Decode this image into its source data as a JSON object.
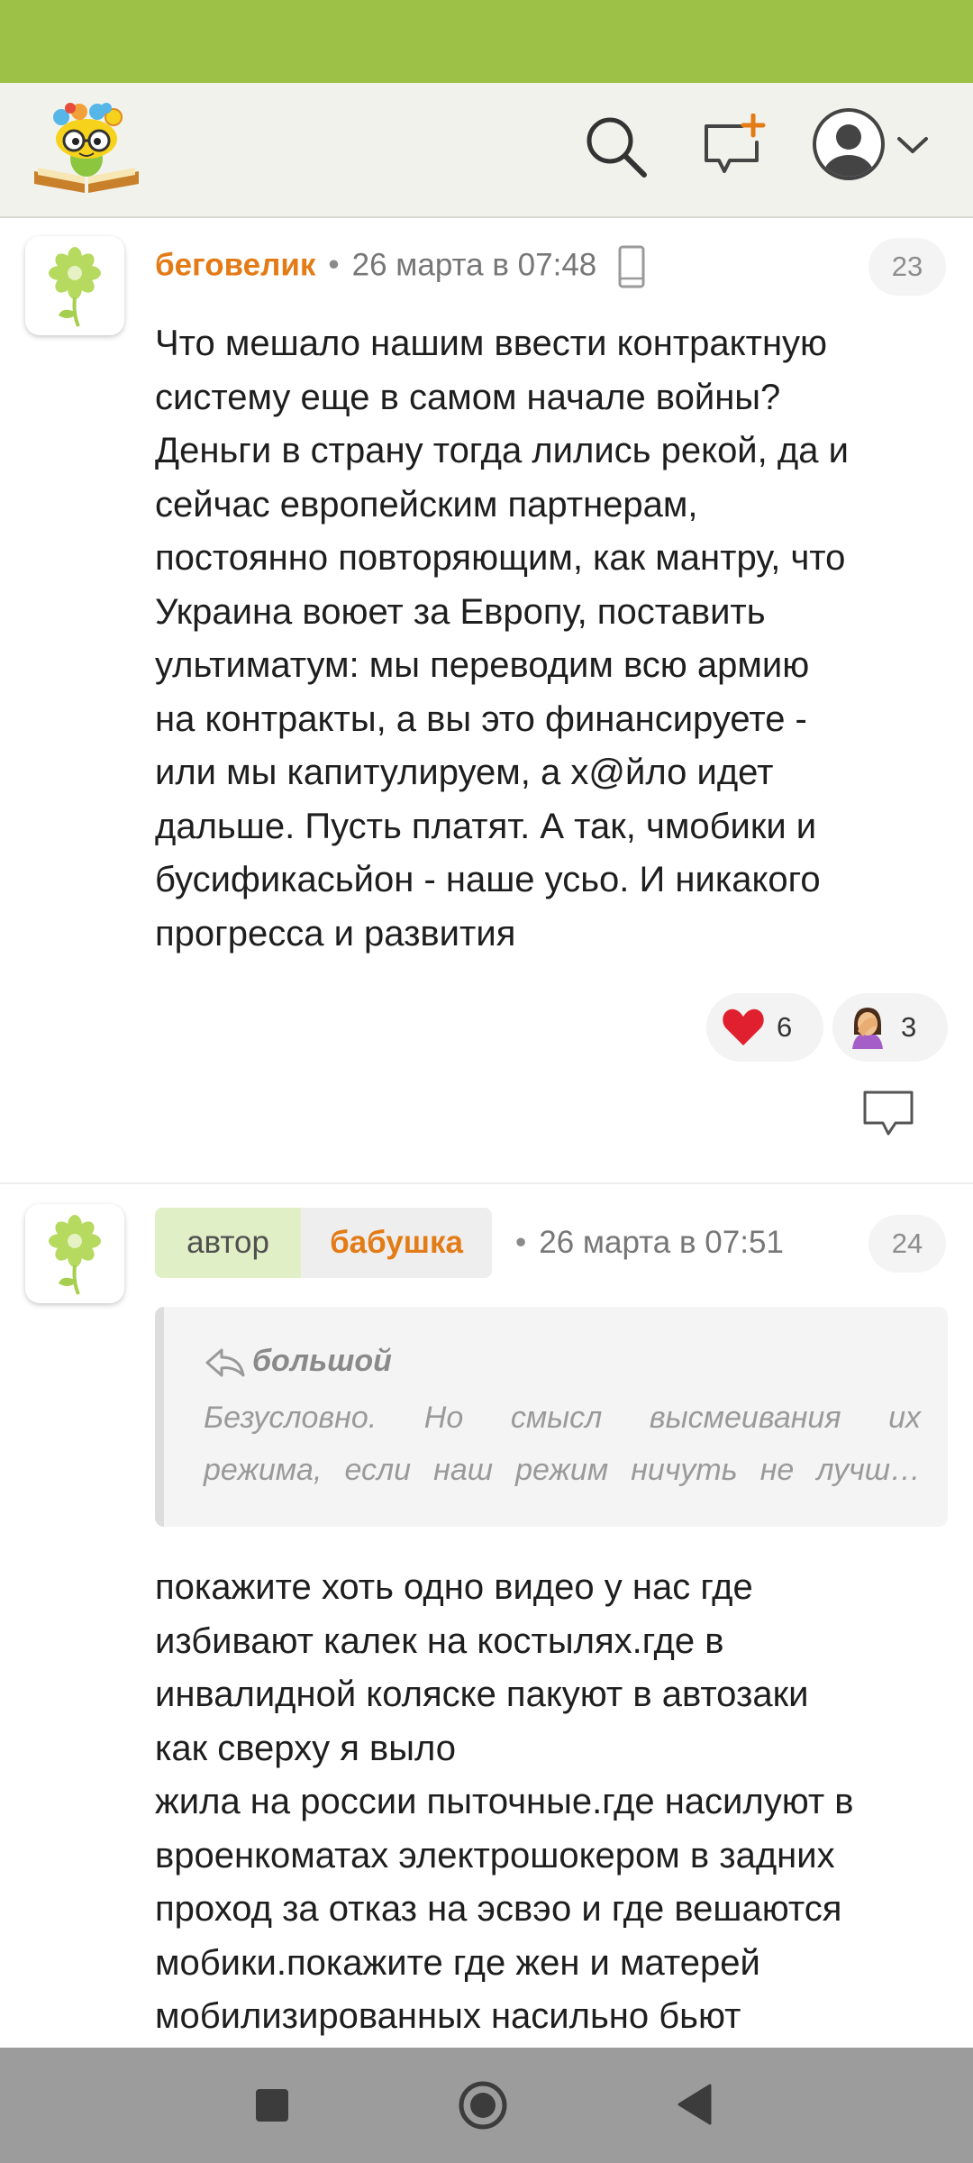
{
  "colors": {
    "status_bar": "#9dc046",
    "header_bg": "#f2f2ed",
    "author_name": "#e37b16",
    "author_badge_bg": "#e1efc7",
    "nav_bar": "#9c9c9c"
  },
  "header": {
    "logo_icon": "site-logo-flower-book",
    "icons": [
      "search-icon",
      "new-post-icon",
      "profile-avatar-icon",
      "chevron-down-icon"
    ]
  },
  "comments": [
    {
      "author": "беговелик",
      "separator": "•",
      "date": "26 марта в 07:48",
      "device_icon": "phone-icon",
      "number": "23",
      "body_lines": [
        "Что мешало нашим ввести контрактную",
        "систему еще в самом начале войны?",
        "Деньги в страну тогда лились рекой, да и",
        "сейчас европейским партнерам,",
        "постоянно повторяющим, как мантру, что",
        "Украина воюет за Европу, поставить",
        "ультиматум: мы переводим всю армию",
        "на контракты, а вы это финансируете -",
        "или мы капитулируем, а х@йло идет",
        "дальше. Пусть платят. А так, чмобики и",
        "бусификасьйон - наше усьо. И никакого",
        "прогресса и развития"
      ],
      "reactions": [
        {
          "icon": "heart-icon",
          "count": "6"
        },
        {
          "icon": "facepalm-icon",
          "count": "3"
        }
      ]
    },
    {
      "author_badge": "автор",
      "author": "бабушка",
      "separator": "•",
      "date": "26 марта в 07:51",
      "number": "24",
      "quote": {
        "author": "большой",
        "lines": [
          "Безусловно.   Но   смысл   высмеивания   их",
          "режима,  если  наш  режим  ничуть  не  лучш…"
        ]
      },
      "body_lines": [
        "покажите хоть одно видео у нас где",
        "избивают калек на костылях.где в",
        "инвалидной коляске пакуют в автозаки",
        "как сверху я выло",
        "жила на россии пыточные.где насилуют в",
        "вроенкоматах электрошокером в задних",
        "проход за отказ на эсвэо и где вешаются",
        "мобики.покажите где жен и матерей",
        "мобилизированных насильно бьют"
      ]
    }
  ]
}
